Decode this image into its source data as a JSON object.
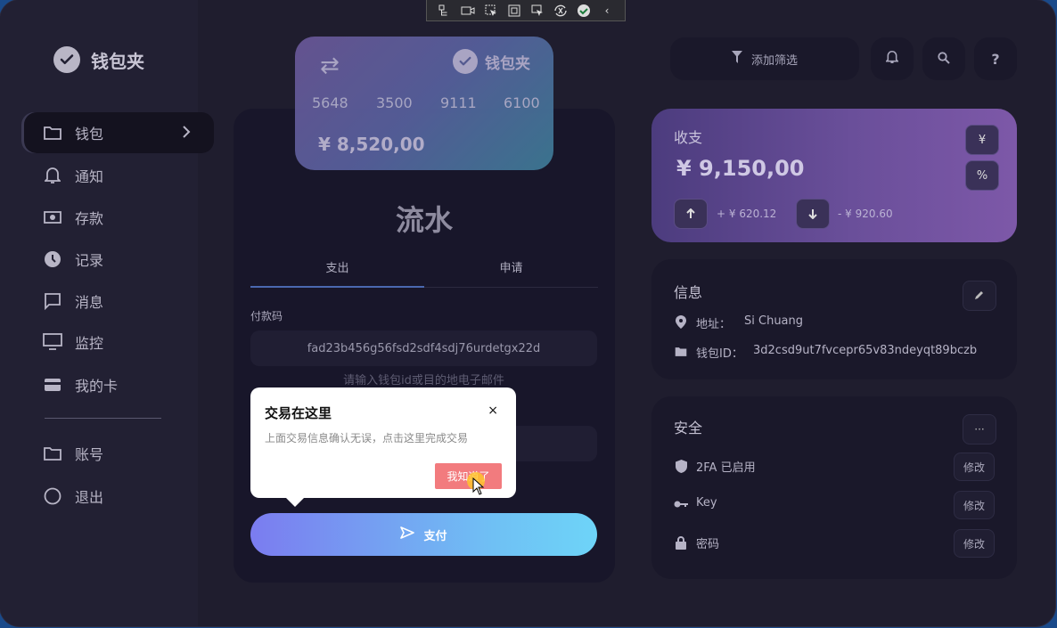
{
  "brand": {
    "name": "钱包夹"
  },
  "toolbar": {
    "collapse": "‹"
  },
  "sidebar": {
    "items": [
      {
        "label": "钱包",
        "icon": "folder-icon"
      },
      {
        "label": "通知",
        "icon": "bell-icon"
      },
      {
        "label": "存款",
        "icon": "cash-icon"
      },
      {
        "label": "记录",
        "icon": "clock-icon"
      },
      {
        "label": "消息",
        "icon": "message-icon"
      },
      {
        "label": "监控",
        "icon": "monitor-icon"
      },
      {
        "label": "我的卡",
        "icon": "card-icon"
      }
    ],
    "bottom": [
      {
        "label": "账号",
        "icon": "folder-icon"
      },
      {
        "label": "退出",
        "icon": "circle-icon"
      }
    ]
  },
  "wallet_card": {
    "brand": "钱包夹",
    "numbers": [
      "5648",
      "3500",
      "9111",
      "6100"
    ],
    "balance": "¥ 8,520,00"
  },
  "flow": {
    "title": "流水",
    "tabs": [
      "支出",
      "申请"
    ],
    "field_label": "付款码",
    "field_value": "fad23b456g56fsd2sdf4sdj76urdetgx22d",
    "hint": "请输入钱包id或目的地电子邮件",
    "pay_label": "支付"
  },
  "popup": {
    "title": "交易在这里",
    "close": "×",
    "desc": "上面交易信息确认无误，点击这里完成交易",
    "button": "我知道了"
  },
  "header": {
    "filter_label": "添加筛选",
    "help": "?"
  },
  "income": {
    "title": "收支",
    "amount": "¥ 9,150,00",
    "yen_btn": "¥",
    "percent_btn": "%",
    "plus": "+ ¥ 620.12",
    "minus": "- ¥ 920.60"
  },
  "info": {
    "title": "信息",
    "address_label": "地址：",
    "address_value": "Si Chuang",
    "wallet_label": "钱包ID：",
    "wallet_value": "3d2csd9ut7fvcepr65v83ndeyqt89bczb"
  },
  "security": {
    "title": "安全",
    "more": "···",
    "rows": [
      {
        "label": "2FA 已启用",
        "icon": "shield-icon",
        "button": "修改"
      },
      {
        "label": "Key",
        "icon": "key-icon",
        "button": "修改"
      },
      {
        "label": "密码",
        "icon": "lock-icon",
        "button": "修改"
      }
    ]
  },
  "colors": {
    "background": "#1f1d2e",
    "sidebar": "#222033",
    "accent_gradient_start": "#7b7cf0",
    "accent_gradient_end": "#6ed4f8",
    "popup_button": "#f27b7e",
    "income_gradient": "#6a4f9a"
  }
}
